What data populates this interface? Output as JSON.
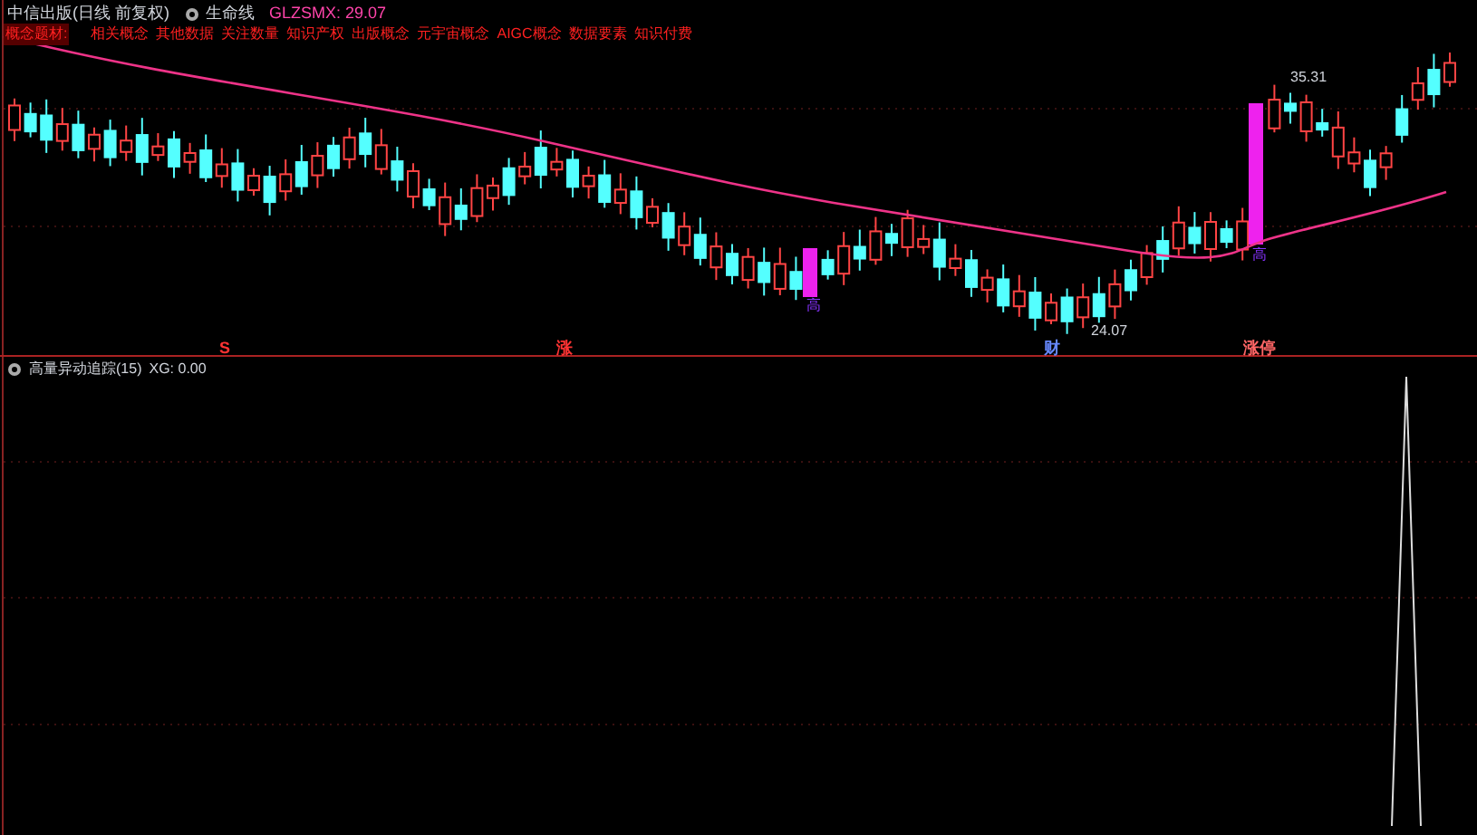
{
  "header": {
    "title": "中信出版(日线 前复权)",
    "indicator": "生命线",
    "reading": "GLZSMX: 29.07"
  },
  "concepts": {
    "label": "概念题材:",
    "items": [
      "相关概念",
      "其他数据",
      "关注数量",
      "知识产权",
      "出版概念",
      "元宇宙概念",
      "AIGC概念",
      "数据要素",
      "知识付费"
    ]
  },
  "price_labels": [
    "35.31",
    "24.07"
  ],
  "candle_tags": [
    "高",
    "高"
  ],
  "axis_markers": [
    {
      "text": "S",
      "color": "#ff3333"
    },
    {
      "text": "涨",
      "color": "#ff3333"
    },
    {
      "text": "财",
      "color": "#6688ff"
    },
    {
      "text": "涨停",
      "color": "#ff6666"
    }
  ],
  "lower_panel": {
    "title": "高量异动追踪(15)",
    "reading": "XG: 0.00"
  }
}
